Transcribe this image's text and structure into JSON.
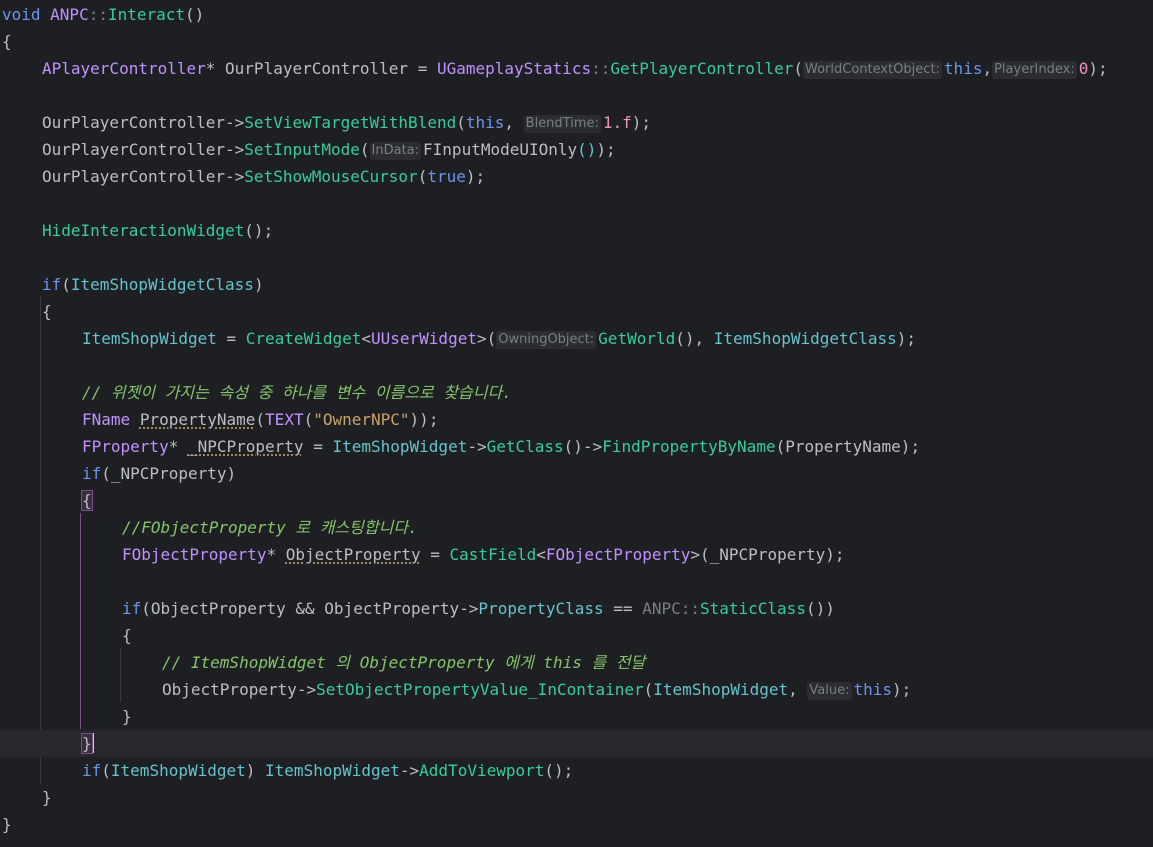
{
  "editor": {
    "lines": [
      [
        {
          "t": "void",
          "c": "kw"
        },
        {
          "t": " ANPC",
          "c": "typ"
        },
        {
          "t": "::",
          "c": "grey"
        },
        {
          "t": "Interact",
          "c": "fn"
        },
        {
          "t": "()",
          "c": "par"
        }
      ],
      [
        {
          "t": "{",
          "c": "par"
        }
      ],
      [
        {
          "t": "APlayerController",
          "c": "typ"
        },
        {
          "t": "* OurPlayerController = ",
          "c": "par"
        },
        {
          "t": "UGameplayStatics",
          "c": "typ"
        },
        {
          "t": "::",
          "c": "grey"
        },
        {
          "t": "GetPlayerController",
          "c": "fn"
        },
        {
          "t": "(",
          "c": "par"
        },
        {
          "h": "WorldContextObject:"
        },
        {
          "t": "this",
          "c": "kw"
        },
        {
          "t": ",",
          "c": "par"
        },
        {
          "h": "PlayerIndex:"
        },
        {
          "t": "0",
          "c": "num"
        },
        {
          "t": ");",
          "c": "par"
        }
      ],
      [],
      [
        {
          "t": "OurPlayerController->",
          "c": "par"
        },
        {
          "t": "SetViewTargetWithBlend",
          "c": "fn"
        },
        {
          "t": "(",
          "c": "par"
        },
        {
          "t": "this",
          "c": "kw"
        },
        {
          "t": ", ",
          "c": "par"
        },
        {
          "h": "BlendTime:"
        },
        {
          "t": "1.f",
          "c": "num"
        },
        {
          "t": ");",
          "c": "par"
        }
      ],
      [
        {
          "t": "OurPlayerController->",
          "c": "par"
        },
        {
          "t": "SetInputMode",
          "c": "fn"
        },
        {
          "t": "(",
          "c": "par"
        },
        {
          "h": "InData:"
        },
        {
          "t": "FInputModeUIOnly",
          "c": "par"
        },
        {
          "t": "()",
          "c": "fnb"
        },
        {
          "t": ");",
          "c": "par"
        }
      ],
      [
        {
          "t": "OurPlayerController->",
          "c": "par"
        },
        {
          "t": "SetShowMouseCursor",
          "c": "fn"
        },
        {
          "t": "(",
          "c": "par"
        },
        {
          "t": "true",
          "c": "kw"
        },
        {
          "t": ");",
          "c": "par"
        }
      ],
      [],
      [
        {
          "t": "HideInteractionWidget",
          "c": "fn"
        },
        {
          "t": "();",
          "c": "par"
        }
      ],
      [],
      [
        {
          "t": "if",
          "c": "kw"
        },
        {
          "t": "(",
          "c": "par"
        },
        {
          "t": "ItemShopWidgetClass",
          "c": "var"
        },
        {
          "t": ")",
          "c": "par"
        }
      ],
      [
        {
          "t": "{",
          "c": "par"
        }
      ],
      [
        {
          "t": "ItemShopWidget",
          "c": "var"
        },
        {
          "t": " = ",
          "c": "par"
        },
        {
          "t": "CreateWidget",
          "c": "fn"
        },
        {
          "t": "<",
          "c": "par"
        },
        {
          "t": "UUserWidget",
          "c": "typ"
        },
        {
          "t": ">(",
          "c": "par"
        },
        {
          "h": "OwningObject:"
        },
        {
          "t": "GetWorld",
          "c": "fn"
        },
        {
          "t": "(), ",
          "c": "par"
        },
        {
          "t": "ItemShopWidgetClass",
          "c": "var"
        },
        {
          "t": ");",
          "c": "par"
        }
      ],
      [],
      [
        {
          "t": "// 위젯이 가지는 속성 중 하나를 변수 이름으로 찾습니다.",
          "c": "cmt"
        }
      ],
      [
        {
          "t": "FName",
          "c": "typ"
        },
        {
          "t": " ",
          "c": "par"
        },
        {
          "t": "PropertyName",
          "c": "par",
          "u": true
        },
        {
          "t": "(",
          "c": "par"
        },
        {
          "t": "TEXT",
          "c": "typ"
        },
        {
          "t": "(",
          "c": "par"
        },
        {
          "t": "\"OwnerNPC\"",
          "c": "str"
        },
        {
          "t": "));",
          "c": "par"
        }
      ],
      [
        {
          "t": "FProperty",
          "c": "typ"
        },
        {
          "t": "* ",
          "c": "par"
        },
        {
          "t": "_NPCProperty",
          "c": "par",
          "u": true
        },
        {
          "t": " = ",
          "c": "par"
        },
        {
          "t": "ItemShopWidget",
          "c": "var"
        },
        {
          "t": "->",
          "c": "par"
        },
        {
          "t": "GetClass",
          "c": "fn"
        },
        {
          "t": "()->",
          "c": "par"
        },
        {
          "t": "FindPropertyByName",
          "c": "fn"
        },
        {
          "t": "(PropertyName);",
          "c": "par"
        }
      ],
      [
        {
          "t": "if",
          "c": "kw"
        },
        {
          "t": "(_NPCProperty)",
          "c": "par"
        }
      ],
      [
        {
          "t": "{",
          "c": "par",
          "b": true
        }
      ],
      [
        {
          "t": "//FObjectProperty 로 캐스팅합니다.",
          "c": "cmt"
        }
      ],
      [
        {
          "t": "FObjectProperty",
          "c": "typ"
        },
        {
          "t": "* ",
          "c": "par"
        },
        {
          "t": "ObjectProperty",
          "c": "par",
          "u": true
        },
        {
          "t": " = ",
          "c": "par"
        },
        {
          "t": "CastField",
          "c": "fn"
        },
        {
          "t": "<",
          "c": "par"
        },
        {
          "t": "FObjectProperty",
          "c": "typ"
        },
        {
          "t": ">(_NPCProperty);",
          "c": "par"
        }
      ],
      [],
      [
        {
          "t": "if",
          "c": "kw"
        },
        {
          "t": "(ObjectProperty && ObjectProperty->",
          "c": "par"
        },
        {
          "t": "PropertyClass",
          "c": "var"
        },
        {
          "t": " == ",
          "c": "par"
        },
        {
          "t": "ANPC",
          "c": "grey"
        },
        {
          "t": "::",
          "c": "grey"
        },
        {
          "t": "StaticClass",
          "c": "fn"
        },
        {
          "t": "())",
          "c": "par"
        }
      ],
      [
        {
          "t": "{",
          "c": "par"
        }
      ],
      [
        {
          "t": "// ItemShopWidget 의 ObjectProperty 에게 this 를 전달",
          "c": "cmt"
        }
      ],
      [
        {
          "t": "ObjectProperty->",
          "c": "par"
        },
        {
          "t": "SetObjectPropertyValue_InContainer",
          "c": "fn"
        },
        {
          "t": "(",
          "c": "par"
        },
        {
          "t": "ItemShopWidget",
          "c": "var"
        },
        {
          "t": ", ",
          "c": "par"
        },
        {
          "h": "Value:"
        },
        {
          "t": "this",
          "c": "kw"
        },
        {
          "t": ");",
          "c": "par"
        }
      ],
      [
        {
          "t": "}",
          "c": "par"
        }
      ],
      [
        {
          "t": "}",
          "c": "par",
          "b": true
        },
        {
          "caret": true
        }
      ],
      [
        {
          "t": "if",
          "c": "kw"
        },
        {
          "t": "(",
          "c": "par"
        },
        {
          "t": "ItemShopWidget",
          "c": "var"
        },
        {
          "t": ") ",
          "c": "par"
        },
        {
          "t": "ItemShopWidget",
          "c": "var"
        },
        {
          "t": "->",
          "c": "par"
        },
        {
          "t": "AddToViewport",
          "c": "fn"
        },
        {
          "t": "();",
          "c": "par"
        }
      ],
      [
        {
          "t": "}",
          "c": "par"
        }
      ],
      [
        {
          "t": "}",
          "c": "par"
        }
      ]
    ]
  }
}
